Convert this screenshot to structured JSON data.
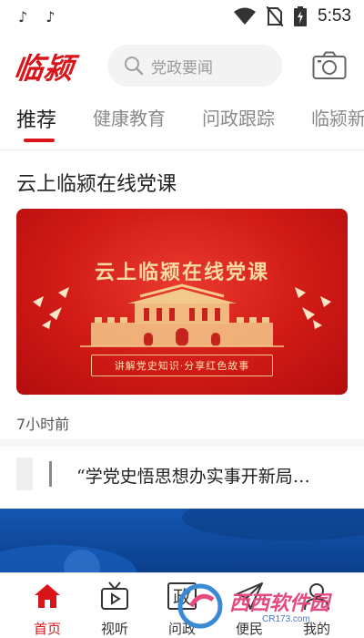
{
  "status_bar": {
    "time": "5:53",
    "icons": [
      "tiktok-icon",
      "tiktok-icon",
      "wifi-icon",
      "no-sim-icon",
      "battery-charging-icon"
    ]
  },
  "header": {
    "logo_text": "临颍",
    "search_placeholder": "党政要闻",
    "camera_icon": "camera-icon"
  },
  "tabs": [
    {
      "label": "推荐",
      "active": true
    },
    {
      "label": "健康教育",
      "active": false
    },
    {
      "label": "问政跟踪",
      "active": false
    },
    {
      "label": "临颍新",
      "active": false
    }
  ],
  "feed": {
    "article1": {
      "title": "云上临颍在线党课",
      "banner_title": "云上临颍在线党课",
      "banner_subtitle": "讲解党史知识·分享红色故事",
      "time": "7小时前"
    },
    "article2": {
      "title": "“学党史悟思想办实事开新局…"
    }
  },
  "bottom_nav": [
    {
      "label": "首页",
      "icon": "home-icon",
      "active": true
    },
    {
      "label": "视听",
      "icon": "tv-icon",
      "active": false
    },
    {
      "label": "问政",
      "icon": "politics-icon",
      "icon_text": "政",
      "active": false
    },
    {
      "label": "便民",
      "icon": "paper-plane-icon",
      "active": false
    },
    {
      "label": "我的",
      "icon": "person-icon",
      "active": false
    }
  ],
  "watermark": {
    "text": "西西软件园",
    "sub": "CR173.com"
  },
  "colors": {
    "brand_red": "#d9151b",
    "banner_gold": "#f8dba4"
  }
}
